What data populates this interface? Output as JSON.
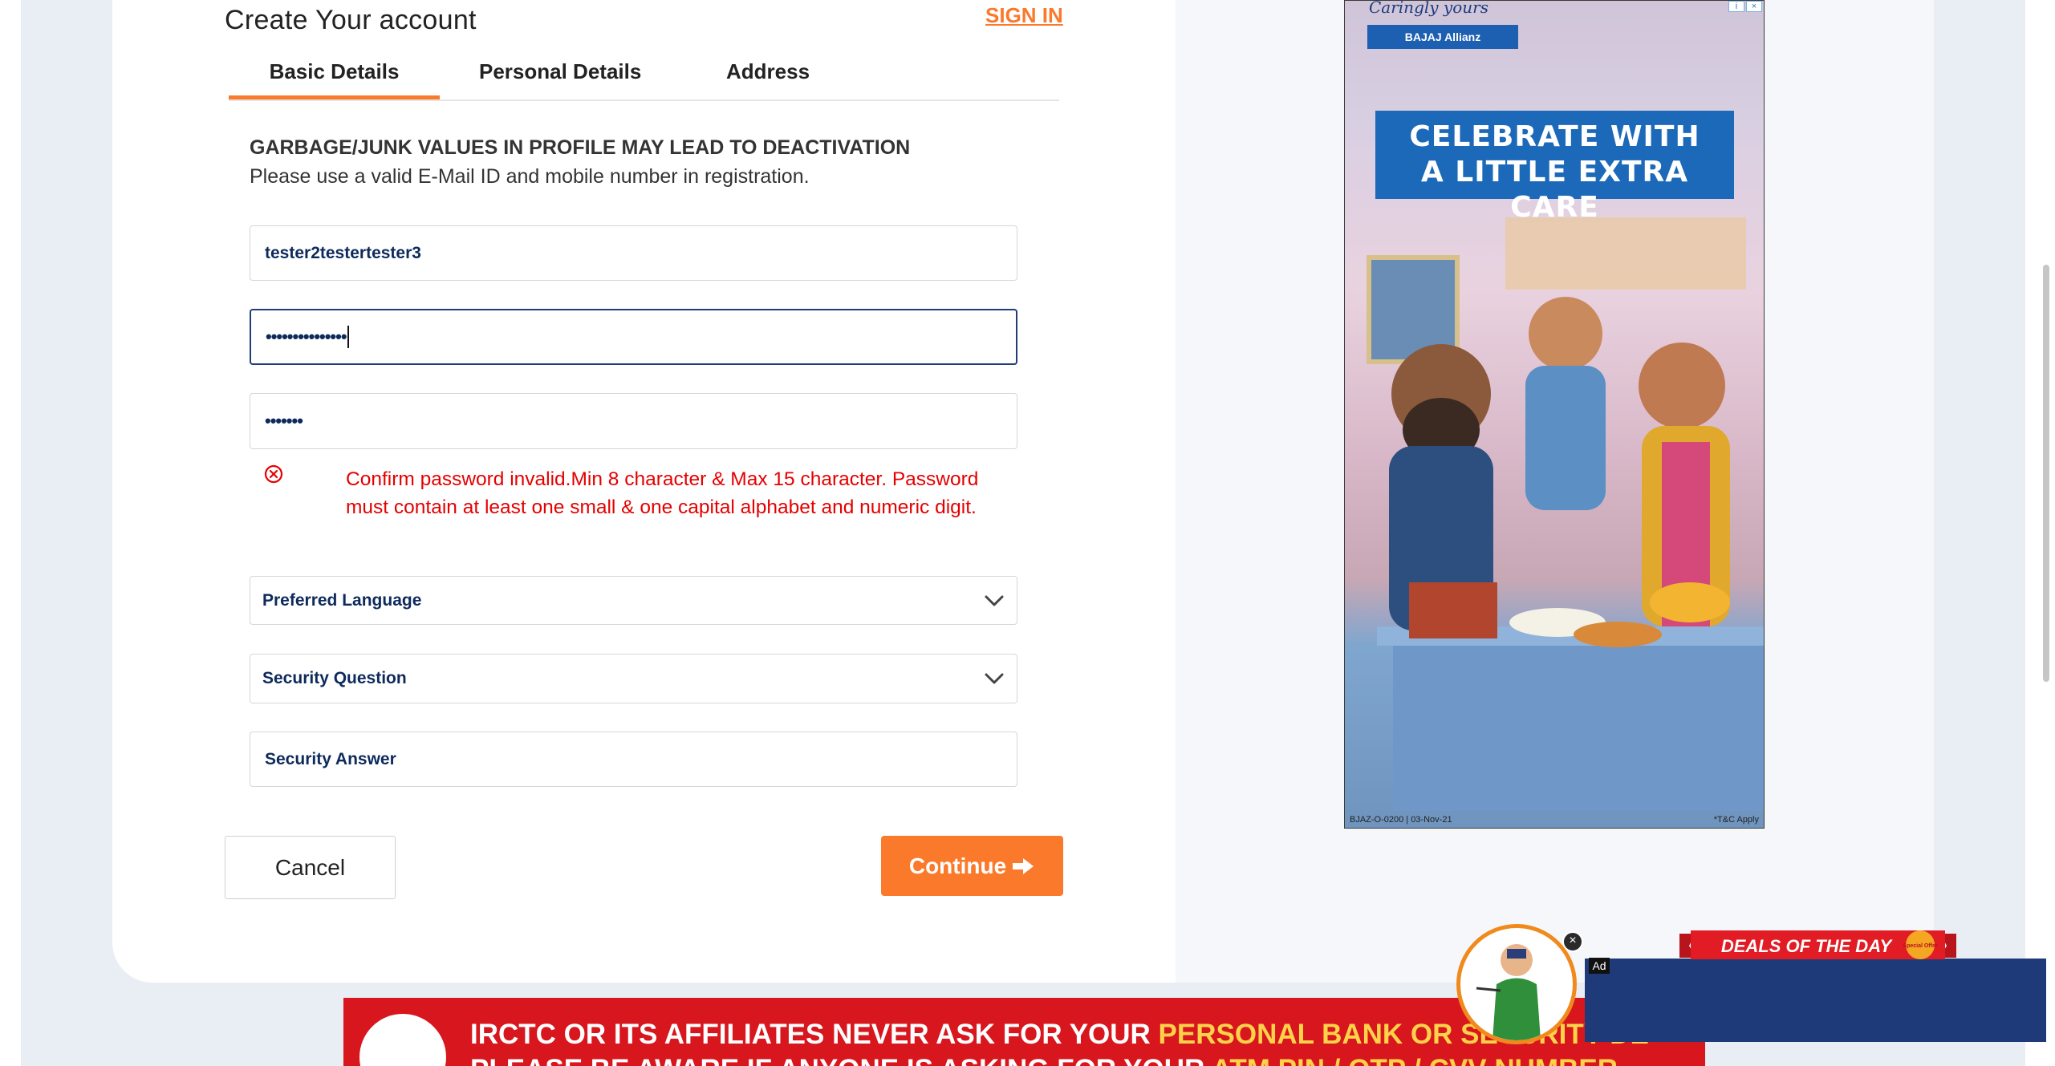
{
  "header": {
    "title": "Create Your account",
    "signin_label": "SIGN IN"
  },
  "tabs": [
    {
      "label": "Basic Details",
      "active": true
    },
    {
      "label": "Personal Details",
      "active": false
    },
    {
      "label": "Address",
      "active": false
    }
  ],
  "notice": {
    "title": "GARBAGE/JUNK VALUES IN PROFILE MAY LEAD TO DEACTIVATION",
    "subtitle": "Please use a valid E-Mail ID and mobile number in registration."
  },
  "form": {
    "username_value": "tester2testertester3",
    "password_value": "•••••••••••••••",
    "confirm_value": "•••••••",
    "error_message": "Confirm password invalid.Min 8 character & Max 15 character. Password must contain at least one small & one capital alphabet and numeric digit.",
    "language_placeholder": "Preferred Language",
    "security_question_placeholder": "Security Question",
    "security_answer_placeholder": "Security Answer"
  },
  "buttons": {
    "cancel_label": "Cancel",
    "continue_label": "Continue"
  },
  "ad": {
    "tagline": "Caringly yours",
    "brand": "BAJAJ Allianz",
    "headline_line1": "CELEBRATE WITH",
    "headline_line2": "A LITTLE EXTRA CARE",
    "footer_left": "BJAZ-O-0200 | 03-Nov-21",
    "footer_right": "*T&C Apply"
  },
  "banner": {
    "line1_plain": "IRCTC OR ITS AFFILIATES NEVER ASK FOR YOUR ",
    "line1_highlight": "PERSONAL BANK OR SECURITY DE",
    "line2_plain": "PLEASE BE AWARE IF ANYONE IS ASKING FOR YOUR ",
    "line2_highlight": "ATM PIN / OTP / CVV NUMBER"
  },
  "deals_widget": {
    "ribbon_label": "DEALS OF THE DAY",
    "badge_label": "Special Offer",
    "ad_label": "Ad",
    "close_symbol": "×"
  },
  "colors": {
    "accent": "#fb792b",
    "error": "#e50000",
    "field_text": "#0e2a5c",
    "focus_border": "#213d77"
  }
}
